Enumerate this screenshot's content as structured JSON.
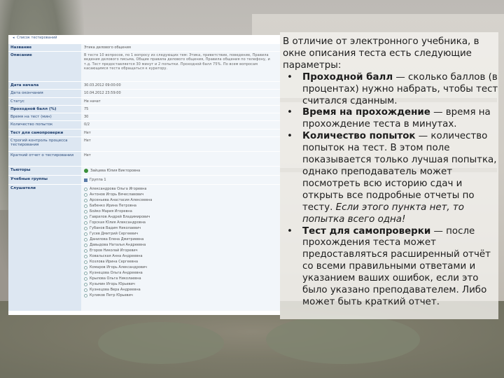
{
  "screenshot": {
    "breadcrumb": "Список тестирований",
    "rows": [
      {
        "label": "Название",
        "value": "Этика делового общения"
      },
      {
        "label": "Описание",
        "value": "В тесте 10 вопросов, по 1 вопросу из следующих тем: Этика, приветствие, поведение, Правила ведения делового письма, Общие правила делового общения, Правила общения по телефону, и т.д. Тест предоставляется 30 минут и 2 попытки. Проходной балл 75%. По всем вопросам касающимся теста обращаться к куратору."
      },
      {
        "label": "Дата начала",
        "value": "30.03.2012 09:00:00"
      },
      {
        "label": "Дата окончания",
        "value": "10.04.2012 23:59:00"
      },
      {
        "label": "Статус",
        "value": "Не начат"
      },
      {
        "label": "Проходной балл (%)",
        "value": "75"
      },
      {
        "label": "Время на тест (мин)",
        "value": "30"
      },
      {
        "label": "Количество попыток",
        "value": "0/2"
      },
      {
        "label": "Тест для самопроверки",
        "value": "Нет"
      },
      {
        "label": "Строгий контроль процесса тестирования",
        "value": "Нет"
      },
      {
        "label": "Краткий отчет о тестировании",
        "value": "Нет"
      },
      {
        "label": "Тьюторы",
        "value": "Зайцева Юлия Викторовна"
      },
      {
        "label": "Учебные группы",
        "value": "Группа 1"
      },
      {
        "label": "Слушатели",
        "value": ""
      }
    ],
    "listeners": [
      "Александрова Ольга Игоревна",
      "Антонов Игорь Вячеславович",
      "Арсеньева Анастасия Алексеевна",
      "Бабенко Ирина Петровна",
      "Бойко Мария Игоревна",
      "Гаврилов Андрей Владимирович",
      "Горская Юлия Александровна",
      "Губанов Вадим Николаевич",
      "Гусев Дмитрий Сергеевич",
      "Данилова Елена Дмитриевна",
      "Давыдова Наталья Андреевна",
      "Егоров Николай Игоревич",
      "Ковальская Анна Андреевна",
      "Козлова Ирина Сергеевна",
      "Комаров Игорь Александрович",
      "Кузнецова Ольга Андреевна",
      "Крылова Ольга Николаевна",
      "Кузьмин Игорь Юрьевич",
      "Кузнецова Вера Андреевна",
      "Куликов Петр Юрьевич"
    ]
  },
  "text": {
    "intro": "В отличие от электронного учебника, в окне описания теста есть следующие параметры:",
    "bullets": [
      {
        "term": "Проходной балл",
        "desc": " — сколько баллов (в процентах) нужно набрать, чтобы тест считался сданным."
      },
      {
        "term": "Время на прохождение",
        "desc": " — время на прохождение теста в минутах."
      },
      {
        "term": "Количество попыток",
        "desc": " — количество попыток на тест. В этом поле показывается только лучшая попытка, однако преподаватель может посмотреть всю историю сдач и открыть все подробные отчеты по тесту. ",
        "emph": "Если этого пункта нет, то попытка всего одна!"
      },
      {
        "term": "Тест для самопроверки",
        "desc": " — после прохождения теста может предоставляться расширенный отчёт со всеми правильными ответами и указанием ваших ошибок, если это было указано преподавателем. Либо может быть краткий отчет."
      }
    ],
    "bullet_char": "•"
  }
}
